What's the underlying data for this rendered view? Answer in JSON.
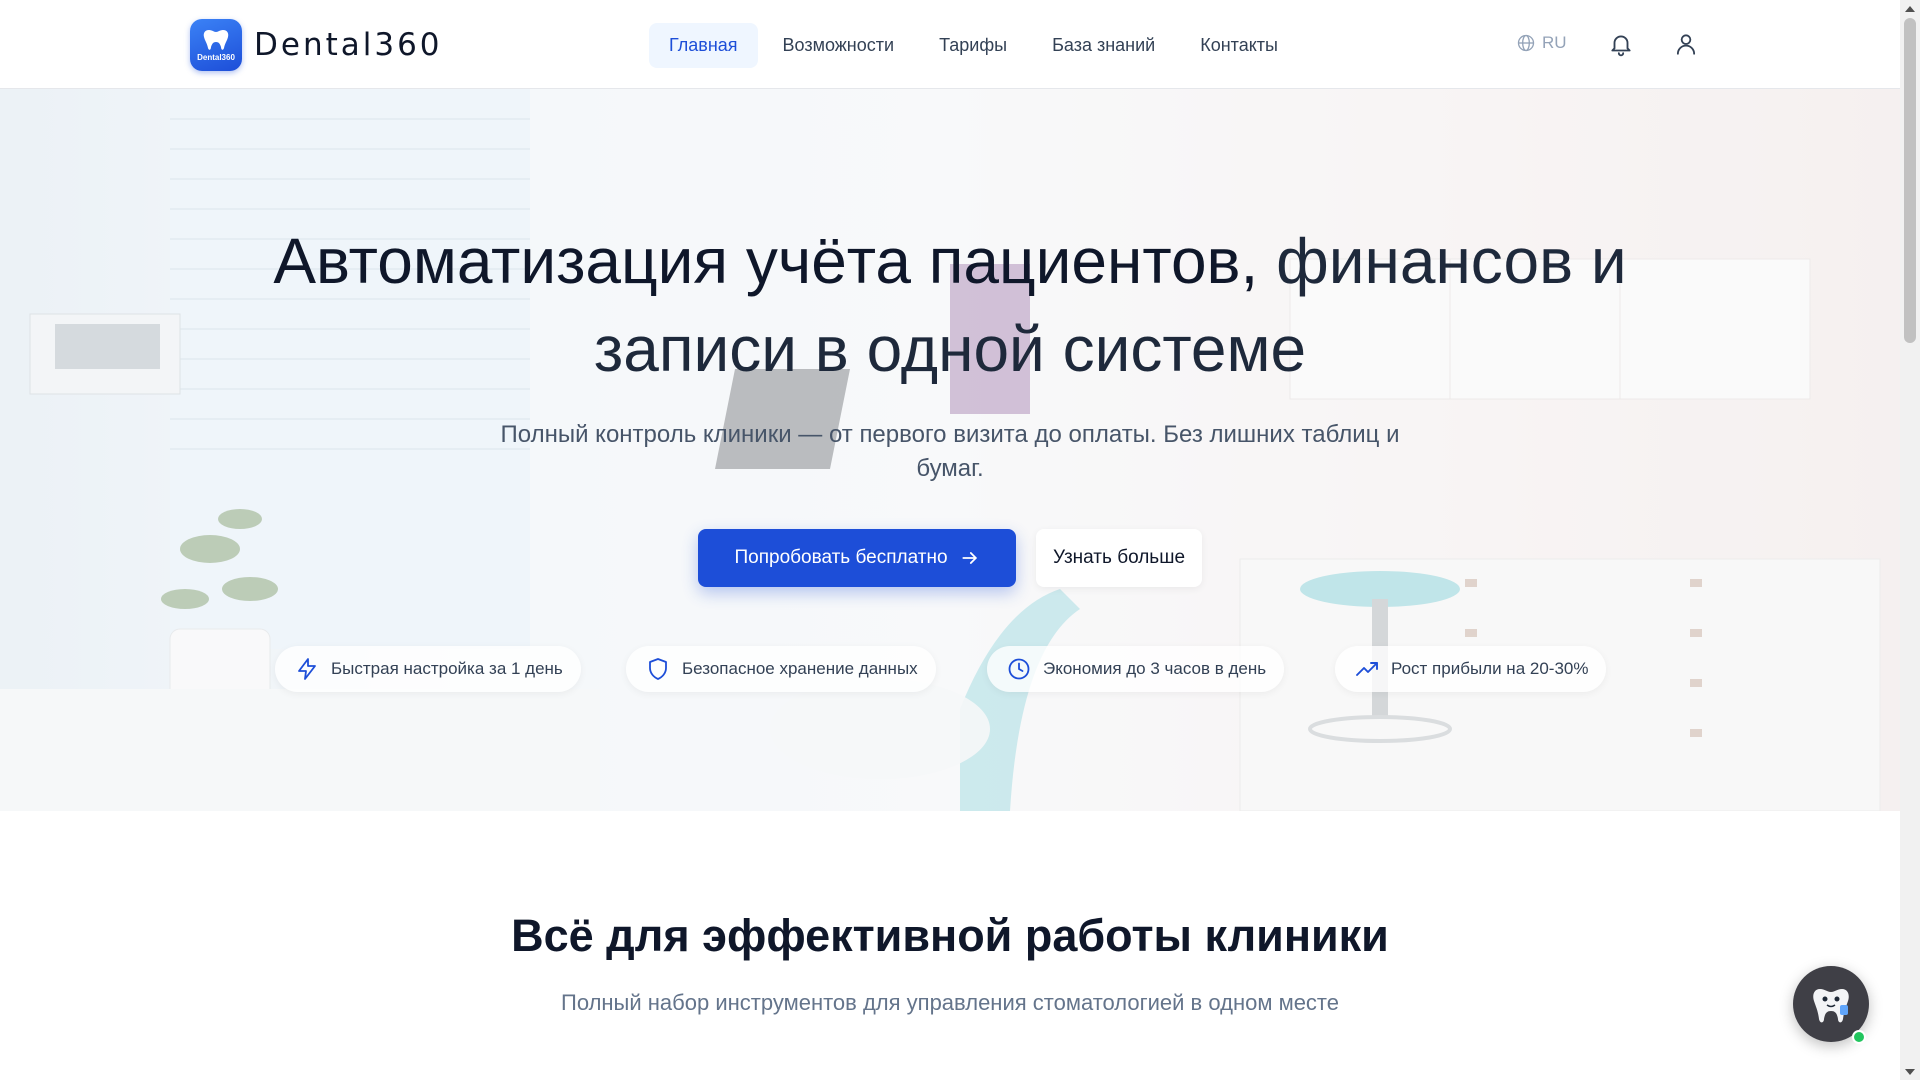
{
  "header": {
    "logo_text": "Dental360",
    "logo_badge_text": "Dental360",
    "nav": [
      {
        "label": "Главная",
        "active": true
      },
      {
        "label": "Возможности",
        "active": false
      },
      {
        "label": "Тарифы",
        "active": false
      },
      {
        "label": "База знаний",
        "active": false
      },
      {
        "label": "Контакты",
        "active": false
      }
    ],
    "language": "RU",
    "icons": [
      "globe-icon",
      "bell-icon",
      "user-icon"
    ]
  },
  "hero": {
    "title_part1": "Автоматизация учёта пациентов,",
    "title_part2": " финансов и записи в одной системе",
    "subtitle": "Полный контроль клиники — от первого визита до оплаты. Без лишних таблиц и бумаг.",
    "primary_button": "Попробовать бесплатно",
    "secondary_button": "Узнать больше",
    "features": [
      {
        "icon": "lightning-icon",
        "label": "Быстрая настройка за 1 день"
      },
      {
        "icon": "shield-icon",
        "label": "Безопасное хранение данных"
      },
      {
        "icon": "clock-icon",
        "label": "Экономия до 3 часов в день"
      },
      {
        "icon": "trending-up-icon",
        "label": "Рост прибыли на 20-30%"
      }
    ]
  },
  "section": {
    "title": "Всё для эффективной работы клиники",
    "subtitle": "Полный набор инструментов для управления стоматологией в одном месте"
  },
  "colors": {
    "accent": "#1d4ed8",
    "nav_active_bg": "#eff6ff",
    "online_dot": "#22c55e"
  }
}
